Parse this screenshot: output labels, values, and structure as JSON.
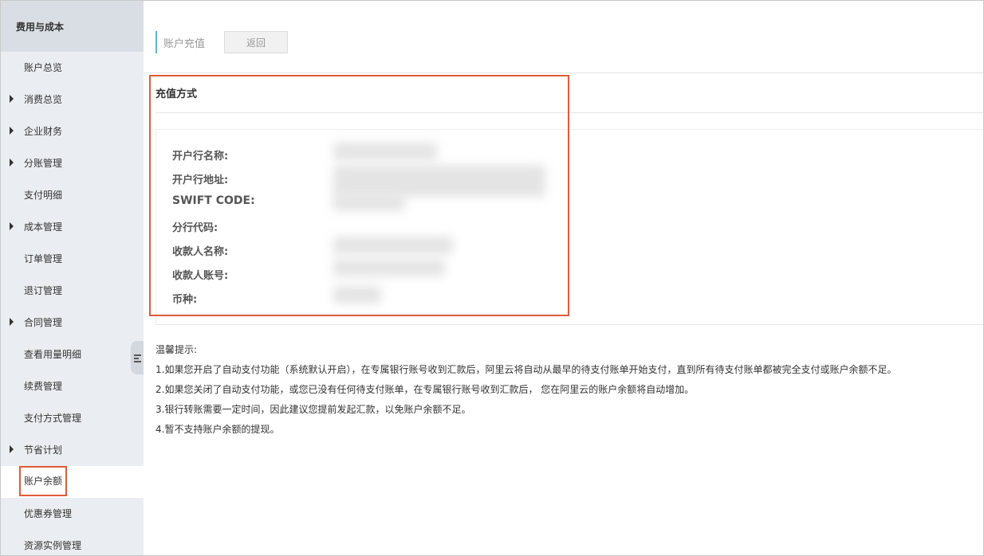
{
  "sidebar": {
    "header": "费用与成本",
    "items": [
      {
        "label": "账户总览",
        "expandable": false,
        "active": false
      },
      {
        "label": "消费总览",
        "expandable": true,
        "active": false
      },
      {
        "label": "企业财务",
        "expandable": true,
        "active": false
      },
      {
        "label": "分账管理",
        "expandable": true,
        "active": false
      },
      {
        "label": "支付明细",
        "expandable": false,
        "active": false
      },
      {
        "label": "成本管理",
        "expandable": true,
        "active": false
      },
      {
        "label": "订单管理",
        "expandable": false,
        "active": false
      },
      {
        "label": "退订管理",
        "expandable": false,
        "active": false
      },
      {
        "label": "合同管理",
        "expandable": true,
        "active": false
      },
      {
        "label": "查看用量明细",
        "expandable": false,
        "active": false
      },
      {
        "label": "续费管理",
        "expandable": false,
        "active": false
      },
      {
        "label": "支付方式管理",
        "expandable": false,
        "active": false
      },
      {
        "label": "节省计划",
        "expandable": true,
        "active": false
      },
      {
        "label": "账户余额",
        "expandable": false,
        "active": true
      },
      {
        "label": "优惠券管理",
        "expandable": false,
        "active": false
      },
      {
        "label": "资源实例管理",
        "expandable": false,
        "active": false
      }
    ]
  },
  "header": {
    "title": "账户充值",
    "back_label": "返回"
  },
  "section": {
    "title": "充值方式",
    "fields": [
      {
        "label": "开户行名称:"
      },
      {
        "label": "开户行地址:"
      },
      {
        "label": "SWIFT CODE:"
      },
      {
        "label": "分行代码:"
      },
      {
        "label": "收款人名称:"
      },
      {
        "label": "收款人账号:"
      },
      {
        "label": "币种:"
      }
    ]
  },
  "tips": {
    "title": "温馨提示:",
    "items": [
      "1.如果您开启了自动支付功能（系统默认开启），在专属银行账号收到汇款后，阿里云将自动从最早的待支付账单开始支付，直到所有待支付账单都被完全支付或账户余额不足。",
      "2.如果您关闭了自动支付功能，或您已没有任何待支付账单，在专属银行账号收到汇款后， 您在阿里云的账户余额将自动增加。",
      "3.银行转账需要一定时间，因此建议您提前发起汇款，以免账户余额不足。",
      "4.暂不支持账户余额的提现。"
    ]
  },
  "colors": {
    "highlight": "#e05a3a",
    "sidebar_bg": "#eaedf1",
    "accent": "#63b3d6"
  }
}
